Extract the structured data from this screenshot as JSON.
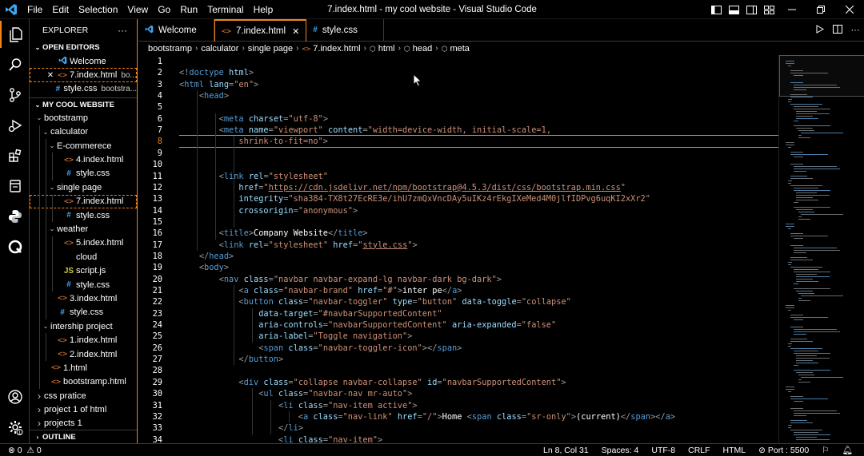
{
  "window": {
    "title": "7.index.html - my cool website - Visual Studio Code",
    "menu": [
      "File",
      "Edit",
      "Selection",
      "View",
      "Go",
      "Run",
      "Terminal",
      "Help"
    ]
  },
  "sidebar": {
    "title": "EXPLORER",
    "more_label": "···",
    "open_editors_label": "OPEN EDITORS",
    "open_editors": [
      {
        "name": "Welcome",
        "icon": "vscode-icon",
        "close": "",
        "path": ""
      },
      {
        "name": "7.index.html",
        "icon": "html-icon",
        "close": "✕",
        "path": "bo..."
      },
      {
        "name": "style.css",
        "icon": "css-icon",
        "close": "",
        "path": "bootstra..."
      }
    ],
    "workspace_label": "MY COOL WEBSITE",
    "tree": [
      {
        "name": "bootstramp",
        "indent": 0,
        "kind": "folder-open"
      },
      {
        "name": "calculator",
        "indent": 1,
        "kind": "folder-open"
      },
      {
        "name": "E-commerece",
        "indent": 2,
        "kind": "folder-open"
      },
      {
        "name": "4.index.html",
        "indent": 3,
        "kind": "html"
      },
      {
        "name": "style.css",
        "indent": 3,
        "kind": "css"
      },
      {
        "name": "single page",
        "indent": 2,
        "kind": "folder-open"
      },
      {
        "name": "7.index.html",
        "indent": 3,
        "kind": "html",
        "state": "focus"
      },
      {
        "name": "style.css",
        "indent": 3,
        "kind": "css"
      },
      {
        "name": "weather",
        "indent": 2,
        "kind": "folder-open"
      },
      {
        "name": "5.index.html",
        "indent": 3,
        "kind": "html"
      },
      {
        "name": "cloud",
        "indent": 3,
        "kind": "cloud"
      },
      {
        "name": "script.js",
        "indent": 3,
        "kind": "js"
      },
      {
        "name": "style.css",
        "indent": 3,
        "kind": "css"
      },
      {
        "name": "3.index.html",
        "indent": 2,
        "kind": "html"
      },
      {
        "name": "style.css",
        "indent": 2,
        "kind": "css"
      },
      {
        "name": "intership project",
        "indent": 1,
        "kind": "folder-open"
      },
      {
        "name": "1.index.html",
        "indent": 2,
        "kind": "html"
      },
      {
        "name": "2.index.html",
        "indent": 2,
        "kind": "html"
      },
      {
        "name": "1.html",
        "indent": 1,
        "kind": "html"
      },
      {
        "name": "bootstramp.html",
        "indent": 1,
        "kind": "html"
      },
      {
        "name": "css pratice",
        "indent": 0,
        "kind": "folder-closed"
      },
      {
        "name": "project 1 of html",
        "indent": 0,
        "kind": "folder-closed"
      },
      {
        "name": "projects 1",
        "indent": 0,
        "kind": "folder-closed"
      }
    ],
    "outline_label": "OUTLINE"
  },
  "tabs": [
    {
      "label": "Welcome",
      "icon": "vscode-icon",
      "active": false
    },
    {
      "label": "7.index.html",
      "icon": "html-icon",
      "active": true,
      "close": "✕"
    },
    {
      "label": "style.css",
      "icon": "css-icon",
      "active": false
    }
  ],
  "breadcrumbs": [
    "bootstramp",
    "calculator",
    "single page",
    "7.index.html",
    "html",
    "head",
    "meta"
  ],
  "editor": {
    "current_line": 8,
    "lines": [
      [],
      [
        [
          "p",
          "<!"
        ],
        [
          "tg",
          "doctype"
        ],
        [
          "t",
          " "
        ],
        [
          "at",
          "html"
        ],
        [
          "p",
          ">"
        ]
      ],
      [
        [
          "p",
          "<"
        ],
        [
          "tg",
          "html"
        ],
        [
          "t",
          " "
        ],
        [
          "at",
          "lang"
        ],
        [
          "p",
          "="
        ],
        [
          "sv",
          "\"en\""
        ],
        [
          "p",
          ">"
        ]
      ],
      [
        [
          "t",
          "    "
        ],
        [
          "p",
          "<"
        ],
        [
          "tg",
          "head"
        ],
        [
          "p",
          ">"
        ]
      ],
      [],
      [
        [
          "t",
          "        "
        ],
        [
          "p",
          "<"
        ],
        [
          "tg",
          "meta"
        ],
        [
          "t",
          " "
        ],
        [
          "at",
          "charset"
        ],
        [
          "p",
          "="
        ],
        [
          "sv",
          "\"utf-8\""
        ],
        [
          "p",
          ">"
        ]
      ],
      [
        [
          "t",
          "        "
        ],
        [
          "p",
          "<"
        ],
        [
          "tg",
          "meta"
        ],
        [
          "t",
          " "
        ],
        [
          "at",
          "name"
        ],
        [
          "p",
          "="
        ],
        [
          "sv",
          "\"viewport\""
        ],
        [
          "t",
          " "
        ],
        [
          "at",
          "content"
        ],
        [
          "p",
          "="
        ],
        [
          "sv",
          "\"width=device-width, initial-scale=1,"
        ]
      ],
      [
        [
          "t",
          "            "
        ],
        [
          "sv",
          "shrink-to-fit=no\""
        ],
        [
          "p",
          ">"
        ]
      ],
      [],
      [],
      [
        [
          "t",
          "        "
        ],
        [
          "p",
          "<"
        ],
        [
          "tg",
          "link"
        ],
        [
          "t",
          " "
        ],
        [
          "at",
          "rel"
        ],
        [
          "p",
          "="
        ],
        [
          "sv",
          "\"stylesheet\""
        ]
      ],
      [
        [
          "t",
          "            "
        ],
        [
          "at",
          "href"
        ],
        [
          "p",
          "="
        ],
        [
          "sv",
          "\""
        ],
        [
          "sv_ul",
          "https://cdn.jsdelivr.net/npm/bootstrap@4.5.3/dist/css/bootstrap.min.css"
        ],
        [
          "sv",
          "\""
        ]
      ],
      [
        [
          "t",
          "            "
        ],
        [
          "at",
          "integrity"
        ],
        [
          "p",
          "="
        ],
        [
          "sv",
          "\"sha384-TX8t27EcRE3e/ihU7zmQxVncDAy5uIKz4rEkgIXeMed4M0jlfIDPvg6uqKI2xXr2\""
        ]
      ],
      [
        [
          "t",
          "            "
        ],
        [
          "at",
          "crossorigin"
        ],
        [
          "p",
          "="
        ],
        [
          "sv",
          "\"anonymous\""
        ],
        [
          "p",
          ">"
        ]
      ],
      [],
      [
        [
          "t",
          "        "
        ],
        [
          "p",
          "<"
        ],
        [
          "tg",
          "title"
        ],
        [
          "p",
          ">"
        ],
        [
          "t",
          "Company Website"
        ],
        [
          "p",
          "</"
        ],
        [
          "tg",
          "title"
        ],
        [
          "p",
          ">"
        ]
      ],
      [
        [
          "t",
          "        "
        ],
        [
          "p",
          "<"
        ],
        [
          "tg",
          "link"
        ],
        [
          "t",
          " "
        ],
        [
          "at",
          "rel"
        ],
        [
          "p",
          "="
        ],
        [
          "sv",
          "\"stylesheet\""
        ],
        [
          "t",
          " "
        ],
        [
          "at",
          "href"
        ],
        [
          "p",
          "="
        ],
        [
          "sv",
          "\""
        ],
        [
          "sv_ul",
          "style.css"
        ],
        [
          "sv",
          "\""
        ],
        [
          "p",
          ">"
        ]
      ],
      [
        [
          "t",
          "    "
        ],
        [
          "p",
          "</"
        ],
        [
          "tg",
          "head"
        ],
        [
          "p",
          ">"
        ]
      ],
      [
        [
          "t",
          "    "
        ],
        [
          "p",
          "<"
        ],
        [
          "tg",
          "body"
        ],
        [
          "p",
          ">"
        ]
      ],
      [
        [
          "t",
          "        "
        ],
        [
          "p",
          "<"
        ],
        [
          "tg",
          "nav"
        ],
        [
          "t",
          " "
        ],
        [
          "at",
          "class"
        ],
        [
          "p",
          "="
        ],
        [
          "sv",
          "\"navbar navbar-expand-lg navbar-dark bg-dark\""
        ],
        [
          "p",
          ">"
        ]
      ],
      [
        [
          "t",
          "            "
        ],
        [
          "p",
          "<"
        ],
        [
          "tg",
          "a"
        ],
        [
          "t",
          " "
        ],
        [
          "at",
          "class"
        ],
        [
          "p",
          "="
        ],
        [
          "sv",
          "\"navbar-brand\""
        ],
        [
          "t",
          " "
        ],
        [
          "at",
          "href"
        ],
        [
          "p",
          "="
        ],
        [
          "sv",
          "\"#\""
        ],
        [
          "p",
          ">"
        ],
        [
          "t",
          "inter pe"
        ],
        [
          "p",
          "</"
        ],
        [
          "tg",
          "a"
        ],
        [
          "p",
          ">"
        ]
      ],
      [
        [
          "t",
          "            "
        ],
        [
          "p",
          "<"
        ],
        [
          "tg",
          "button"
        ],
        [
          "t",
          " "
        ],
        [
          "at",
          "class"
        ],
        [
          "p",
          "="
        ],
        [
          "sv",
          "\"navbar-toggler\""
        ],
        [
          "t",
          " "
        ],
        [
          "at",
          "type"
        ],
        [
          "p",
          "="
        ],
        [
          "sv",
          "\"button\""
        ],
        [
          "t",
          " "
        ],
        [
          "at",
          "data-toggle"
        ],
        [
          "p",
          "="
        ],
        [
          "sv",
          "\"collapse\""
        ]
      ],
      [
        [
          "t",
          "                "
        ],
        [
          "at",
          "data-target"
        ],
        [
          "p",
          "="
        ],
        [
          "sv",
          "\"#navbarSupportedContent\""
        ]
      ],
      [
        [
          "t",
          "                "
        ],
        [
          "at",
          "aria-controls"
        ],
        [
          "p",
          "="
        ],
        [
          "sv",
          "\"navbarSupportedContent\""
        ],
        [
          "t",
          " "
        ],
        [
          "at",
          "aria-expanded"
        ],
        [
          "p",
          "="
        ],
        [
          "sv",
          "\"false\""
        ]
      ],
      [
        [
          "t",
          "                "
        ],
        [
          "at",
          "aria-label"
        ],
        [
          "p",
          "="
        ],
        [
          "sv",
          "\"Toggle navigation\""
        ],
        [
          "p",
          ">"
        ]
      ],
      [
        [
          "t",
          "                "
        ],
        [
          "p",
          "<"
        ],
        [
          "tg",
          "span"
        ],
        [
          "t",
          " "
        ],
        [
          "at",
          "class"
        ],
        [
          "p",
          "="
        ],
        [
          "sv",
          "\"navbar-toggler-icon\""
        ],
        [
          "p",
          ">"
        ],
        [
          "p",
          "</"
        ],
        [
          "tg",
          "span"
        ],
        [
          "p",
          ">"
        ]
      ],
      [
        [
          "t",
          "            "
        ],
        [
          "p",
          "</"
        ],
        [
          "tg",
          "button"
        ],
        [
          "p",
          ">"
        ]
      ],
      [],
      [
        [
          "t",
          "            "
        ],
        [
          "p",
          "<"
        ],
        [
          "tg",
          "div"
        ],
        [
          "t",
          " "
        ],
        [
          "at",
          "class"
        ],
        [
          "p",
          "="
        ],
        [
          "sv",
          "\"collapse navbar-collapse\""
        ],
        [
          "t",
          " "
        ],
        [
          "at",
          "id"
        ],
        [
          "p",
          "="
        ],
        [
          "sv",
          "\"navbarSupportedContent\""
        ],
        [
          "p",
          ">"
        ]
      ],
      [
        [
          "t",
          "                "
        ],
        [
          "p",
          "<"
        ],
        [
          "tg",
          "ul"
        ],
        [
          "t",
          " "
        ],
        [
          "at",
          "class"
        ],
        [
          "p",
          "="
        ],
        [
          "sv",
          "\"navbar-nav mr-auto\""
        ],
        [
          "p",
          ">"
        ]
      ],
      [
        [
          "t",
          "                    "
        ],
        [
          "p",
          "<"
        ],
        [
          "tg",
          "li"
        ],
        [
          "t",
          " "
        ],
        [
          "at",
          "class"
        ],
        [
          "p",
          "="
        ],
        [
          "sv",
          "\"nav-item active\""
        ],
        [
          "p",
          ">"
        ]
      ],
      [
        [
          "t",
          "                        "
        ],
        [
          "p",
          "<"
        ],
        [
          "tg",
          "a"
        ],
        [
          "t",
          " "
        ],
        [
          "at",
          "class"
        ],
        [
          "p",
          "="
        ],
        [
          "sv",
          "\"nav-link\""
        ],
        [
          "t",
          " "
        ],
        [
          "at",
          "href"
        ],
        [
          "p",
          "="
        ],
        [
          "sv",
          "\"/\""
        ],
        [
          "p",
          ">"
        ],
        [
          "t",
          "Home "
        ],
        [
          "p",
          "<"
        ],
        [
          "tg",
          "span"
        ],
        [
          "t",
          " "
        ],
        [
          "at",
          "class"
        ],
        [
          "p",
          "="
        ],
        [
          "sv",
          "\"sr-only\""
        ],
        [
          "p",
          ">"
        ],
        [
          "t",
          "(current)"
        ],
        [
          "p",
          "</"
        ],
        [
          "tg",
          "span"
        ],
        [
          "p",
          "></"
        ],
        [
          "tg",
          "a"
        ],
        [
          "p",
          ">"
        ]
      ],
      [
        [
          "t",
          "                    "
        ],
        [
          "p",
          "</"
        ],
        [
          "tg",
          "li"
        ],
        [
          "p",
          ">"
        ]
      ],
      [
        [
          "t",
          "                    "
        ],
        [
          "p",
          "<"
        ],
        [
          "tg",
          "li"
        ],
        [
          "t",
          " "
        ],
        [
          "at",
          "class"
        ],
        [
          "p",
          "="
        ],
        [
          "sv",
          "\"nav-item\""
        ],
        [
          "p",
          ">"
        ]
      ]
    ]
  },
  "status": {
    "problems": "0",
    "warnings": "0",
    "position": "Ln 8, Col 31",
    "spaces": "Spaces: 4",
    "encoding": "UTF-8",
    "eol": "CRLF",
    "language": "HTML",
    "port": "Port : 5500"
  },
  "colors": {
    "accent": "#f38518",
    "tag": "#569cd6",
    "attr": "#9cdcfe",
    "string": "#ce9178"
  }
}
